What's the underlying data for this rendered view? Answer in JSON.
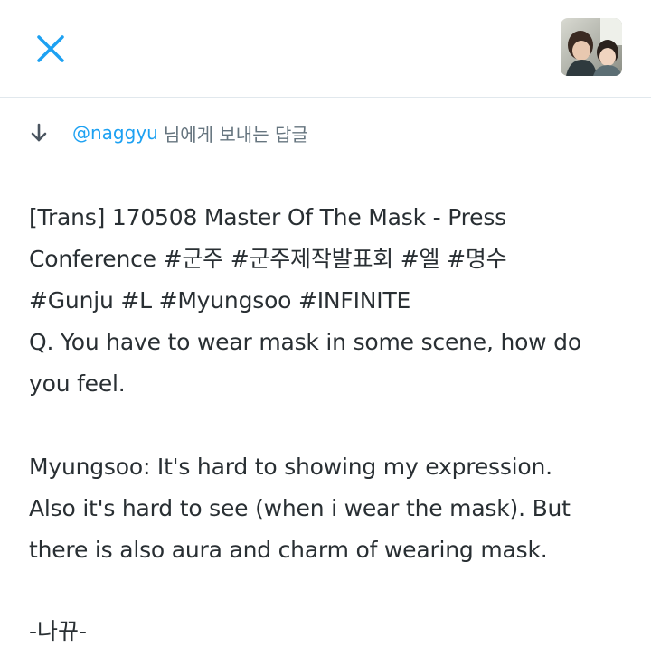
{
  "header": {
    "close_icon": "close-icon",
    "avatar_icon": "profile-avatar"
  },
  "reply_context": {
    "icon": "reply-down-arrow-icon",
    "mention": "@naggyu",
    "suffix": "님에게 보내는 답글"
  },
  "tweet": {
    "lines": [
      "[Trans] 170508 Master Of The Mask - Press",
      "Conference #군주 #군주제작발표회 #엘 #명수",
      "#Gunju #L #Myungsoo #INFINITE",
      "Q. You have to wear mask in some scene, how do",
      "you feel.",
      "",
      "Myungsoo: It's hard to showing my expression.",
      "Also it's hard to see (when i wear the mask). But",
      "there is also aura and charm of wearing mask."
    ],
    "signature": "-나뀨-"
  },
  "colors": {
    "accent": "#1da1f2",
    "text": "#292f33",
    "muted": "#66757f",
    "divider": "#e1e8ed"
  }
}
